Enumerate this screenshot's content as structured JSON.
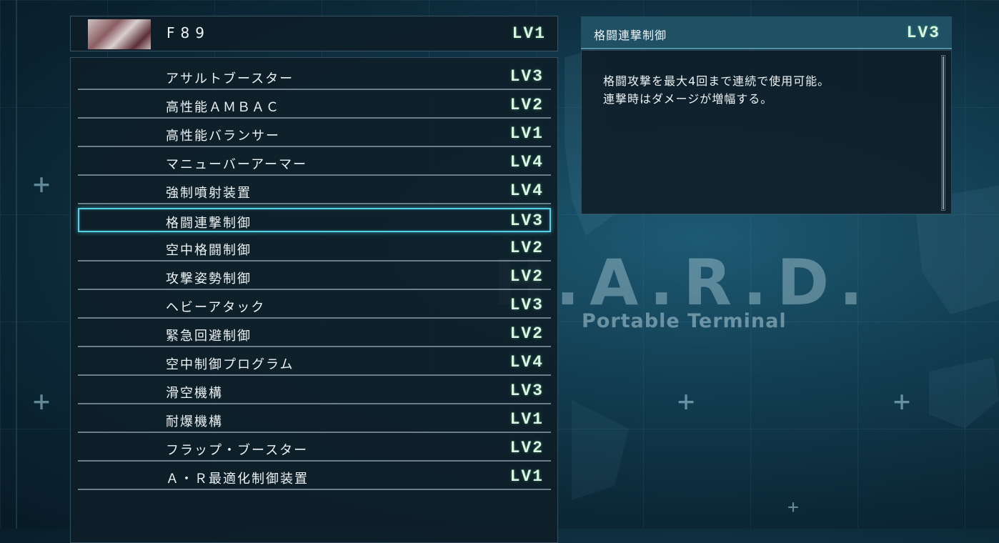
{
  "mech": {
    "name": "F89",
    "level": "LV1"
  },
  "skills": [
    {
      "name": "アサルトブースター",
      "level": "LV3"
    },
    {
      "name": "高性能ＡＭＢＡＣ",
      "level": "LV2"
    },
    {
      "name": "高性能バランサー",
      "level": "LV1"
    },
    {
      "name": "マニューバーアーマー",
      "level": "LV4"
    },
    {
      "name": "強制噴射装置",
      "level": "LV4"
    },
    {
      "name": "格闘連撃制御",
      "level": "LV3"
    },
    {
      "name": "空中格闘制御",
      "level": "LV2"
    },
    {
      "name": "攻撃姿勢制御",
      "level": "LV2"
    },
    {
      "name": "ヘビーアタック",
      "level": "LV3"
    },
    {
      "name": "緊急回避制御",
      "level": "LV2"
    },
    {
      "name": "空中制御プログラム",
      "level": "LV4"
    },
    {
      "name": "滑空機構",
      "level": "LV3"
    },
    {
      "name": "耐爆機構",
      "level": "LV1"
    },
    {
      "name": "フラップ・ブースター",
      "level": "LV2"
    },
    {
      "name": "Ａ・Ｒ最適化制御装置",
      "level": "LV1"
    }
  ],
  "selected_index": 5,
  "detail": {
    "title": "格闘連撃制御",
    "level": "LV3",
    "description": [
      "格闘攻撃を最大4回まで連続で使用可能。",
      "連撃時はダメージが増幅する。"
    ]
  },
  "background": {
    "logo": "H.A.R.D.",
    "subtitle": "Portable Terminal"
  },
  "colors": {
    "accent": "#53d2e6",
    "level_text": "#d8f5e0",
    "panel": "#0e1e28"
  }
}
